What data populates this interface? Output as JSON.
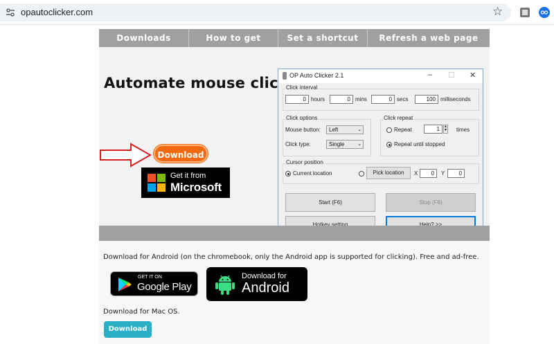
{
  "browser": {
    "url": "opautoclicker.com"
  },
  "nav": {
    "items": [
      "Downloads",
      "How to get started",
      "Set a shortcut",
      "Refresh a web page"
    ]
  },
  "hero": {
    "title": "Automate mouse clicks",
    "download_label": "Download",
    "ms_line1": "Get it from",
    "ms_line2": "Microsoft"
  },
  "app": {
    "title": "OP Auto Clicker 2.1",
    "click_interval_label": "Click interval",
    "hours_value": "0",
    "hours_label": "hours",
    "mins_value": "0",
    "mins_label": "mins",
    "secs_value": "0",
    "secs_label": "secs",
    "ms_value": "100",
    "ms_label": "milliseconds",
    "click_options_label": "Click options",
    "mouse_button_label": "Mouse button:",
    "mouse_button_value": "Left",
    "click_type_label": "Click type:",
    "click_type_value": "Single",
    "click_repeat_label": "Click repeat",
    "repeat_label": "Repeat",
    "repeat_value": "1",
    "times_label": "times",
    "repeat_until_label": "Repeat until stopped",
    "cursor_position_label": "Cursor position",
    "current_location_label": "Current location",
    "pick_location_label": "Pick location",
    "x_label": "X",
    "x_value": "0",
    "y_label": "Y",
    "y_value": "0",
    "start_label": "Start (F6)",
    "stop_label": "Stop (F6)",
    "hotkey_label": "Hotkey setting",
    "help_label": "Help? >>"
  },
  "lower": {
    "android_text": "Download for Android (on the chromebook, only the Android app is supported for clicking). Free and ad-free.",
    "gplay_line1": "GET IT ON",
    "gplay_line2": "Google Play",
    "android_line1": "Download for",
    "android_line2": "Android",
    "mac_text": "Download for Mac OS.",
    "mac_download_label": "Download"
  }
}
